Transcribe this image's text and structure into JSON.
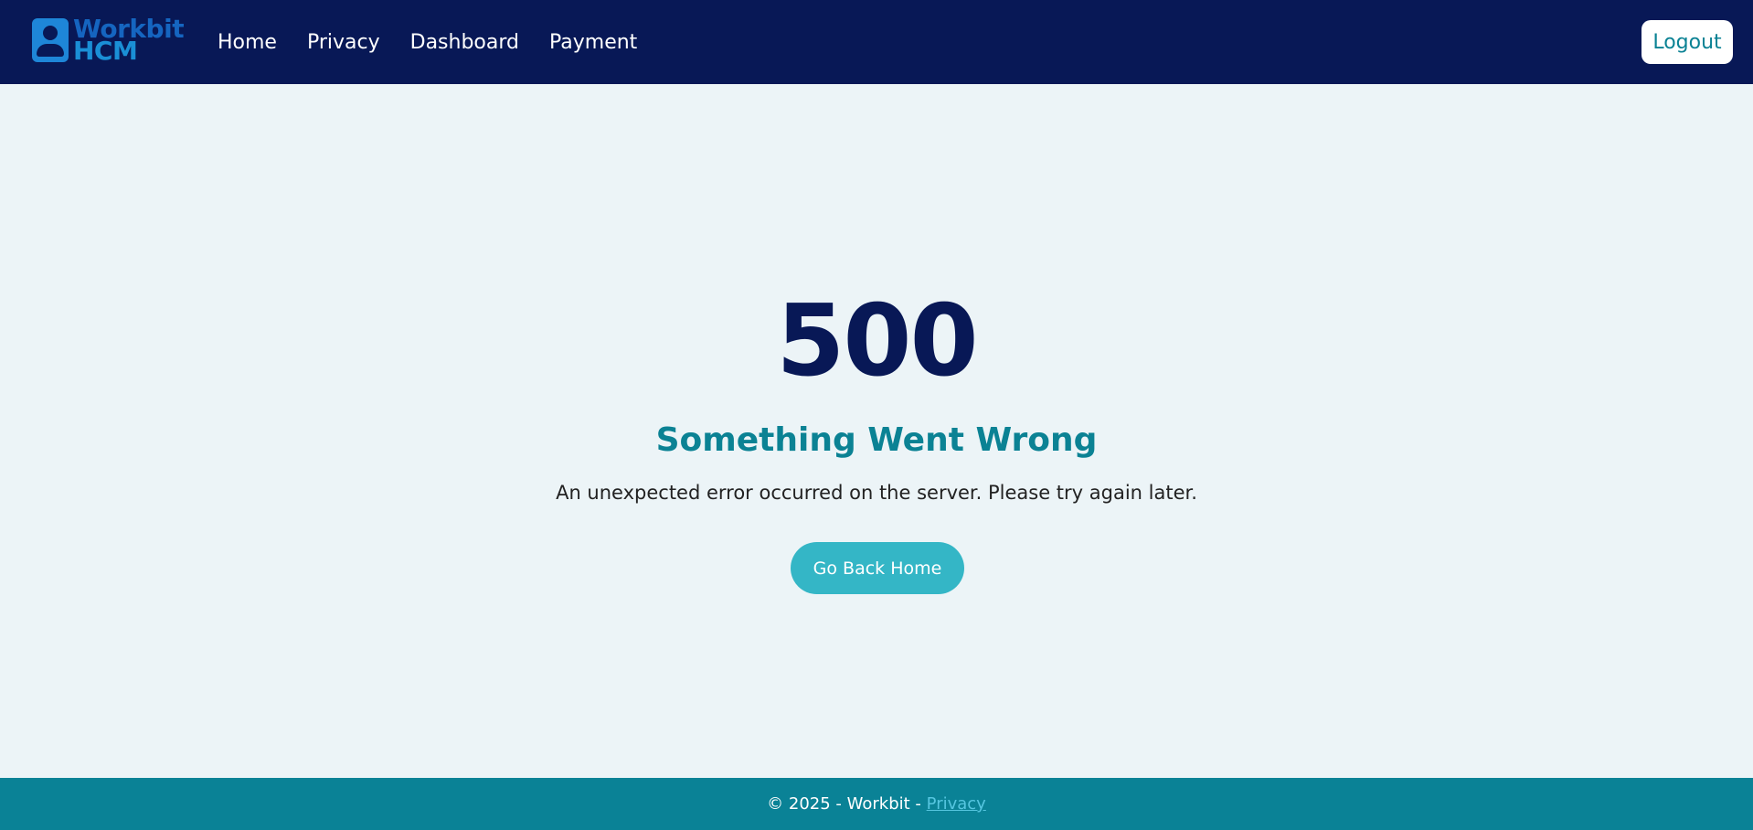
{
  "brand": {
    "line1": "Workbit",
    "line2": "HCM",
    "icon": "user-badge-icon"
  },
  "nav": {
    "links": [
      "Home",
      "Privacy",
      "Dashboard",
      "Payment"
    ],
    "logout_label": "Logout"
  },
  "error": {
    "code": "500",
    "title": "Something Went Wrong",
    "message": "An unexpected error occurred on the server. Please try again later.",
    "button_label": "Go Back Home"
  },
  "footer": {
    "text": "© 2025 - Workbit - ",
    "privacy_link": "Privacy"
  },
  "colors": {
    "navbar_bg": "#081856",
    "page_bg": "#ecf4f7",
    "accent": "#0b8294",
    "button_bg": "#34b6c6",
    "footer_bg": "#0a8296"
  }
}
